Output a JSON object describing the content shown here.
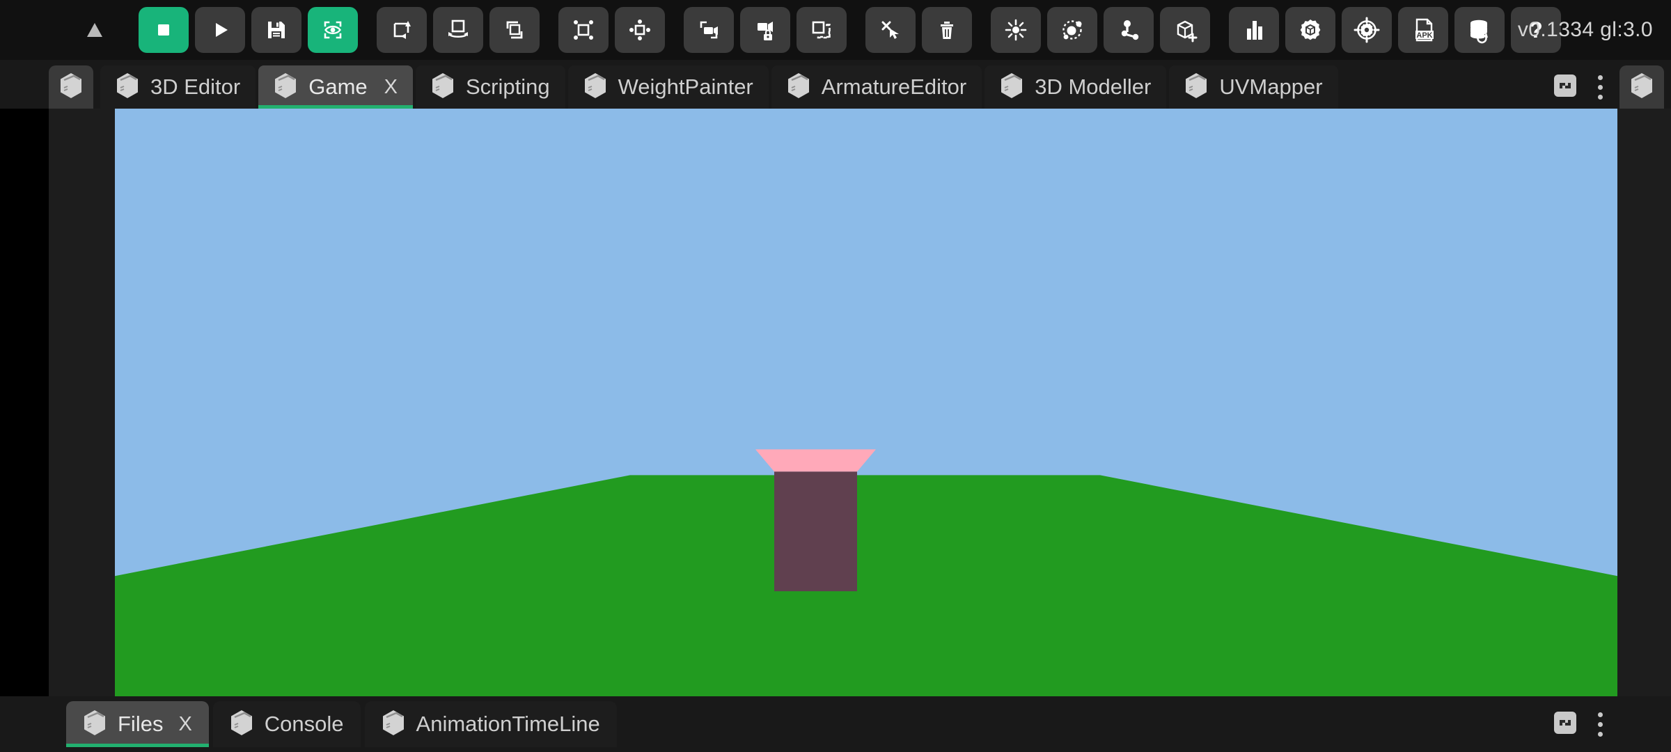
{
  "app": {
    "version_label": "v0.1334 gl:3.0",
    "accent_color": "#22b06f",
    "toolbar_active_color": "#18b47a",
    "panel_bg": "#1d1d1d",
    "chrome_bg": "#191919",
    "button_bg": "#3b3b3b"
  },
  "toolbar": {
    "buttons": [
      {
        "name": "collapse-toolbar-button",
        "icon": "triangle-up-icon",
        "label": "Collapse",
        "state": "normal"
      },
      {
        "name": "stop-button",
        "icon": "stop-square-icon",
        "label": "Stop",
        "state": "active"
      },
      {
        "name": "play-button",
        "icon": "play-triangle-icon",
        "label": "Play",
        "state": "normal"
      },
      {
        "name": "save-button",
        "icon": "floppy-disk-icon",
        "label": "Save",
        "state": "normal"
      },
      {
        "name": "preview-visibility-button",
        "icon": "eye-frame-icon",
        "label": "Preview",
        "state": "active"
      },
      {
        "name": "move-object-button",
        "icon": "square-arrow-loop-icon",
        "label": "Move",
        "state": "normal"
      },
      {
        "name": "rotate-object-button",
        "icon": "square-rotate-icon",
        "label": "Rotate",
        "state": "normal"
      },
      {
        "name": "scale-object-button",
        "icon": "square-overlap-icon",
        "label": "Scale",
        "state": "normal"
      },
      {
        "name": "select-box-button",
        "icon": "square-corner-dots-icon",
        "label": "Select Box",
        "state": "normal"
      },
      {
        "name": "pivot-button",
        "icon": "square-side-dots-icon",
        "label": "Pivot",
        "state": "normal"
      },
      {
        "name": "camera-add-button",
        "icon": "camera-frame-icon",
        "label": "Add Camera",
        "state": "normal"
      },
      {
        "name": "camera-lock-button",
        "icon": "camera-lock-icon",
        "label": "Lock Camera",
        "state": "normal"
      },
      {
        "name": "duplicate-button",
        "icon": "square-dashed-copy-icon",
        "label": "Duplicate",
        "state": "normal"
      },
      {
        "name": "click-select-button",
        "icon": "cursor-sparkle-icon",
        "label": "Click Select",
        "state": "normal"
      },
      {
        "name": "delete-button",
        "icon": "trash-icon",
        "label": "Delete",
        "state": "normal"
      },
      {
        "name": "light-button",
        "icon": "sun-light-icon",
        "label": "Light",
        "state": "normal"
      },
      {
        "name": "particle-button",
        "icon": "atom-orbit-icon",
        "label": "Particles",
        "state": "normal"
      },
      {
        "name": "node-graph-button",
        "icon": "node-network-icon",
        "label": "Nodes",
        "state": "normal"
      },
      {
        "name": "add-primitive-button",
        "icon": "cube-plus-icon",
        "label": "Add Primitive",
        "state": "normal"
      },
      {
        "name": "statistics-button",
        "icon": "bar-chart-icon",
        "label": "Statistics",
        "state": "normal"
      },
      {
        "name": "object-settings-button",
        "icon": "gear-cube-icon",
        "label": "Object Settings",
        "state": "normal"
      },
      {
        "name": "engine-settings-button",
        "icon": "gear-target-icon",
        "label": "Engine Settings",
        "state": "normal"
      },
      {
        "name": "export-apk-button",
        "icon": "apk-file-icon",
        "label": "Export APK",
        "state": "normal"
      },
      {
        "name": "database-refresh-button",
        "icon": "database-refresh-icon",
        "label": "Reload Assets",
        "state": "normal"
      },
      {
        "name": "help-button",
        "icon": "question-mark-icon",
        "label": "Help",
        "state": "normal"
      }
    ]
  },
  "top_tabs": {
    "corner_icon": "cube-icon",
    "items": [
      {
        "label": "3D Editor",
        "icon": "cube-icon",
        "active": false,
        "closable": false
      },
      {
        "label": "Game",
        "icon": "cube-icon",
        "active": true,
        "closable": true,
        "close_label": "X"
      },
      {
        "label": "Scripting",
        "icon": "cube-icon",
        "active": false,
        "closable": false
      },
      {
        "label": "WeightPainter",
        "icon": "cube-icon",
        "active": false,
        "closable": false
      },
      {
        "label": "ArmatureEditor",
        "icon": "cube-icon",
        "active": false,
        "closable": false
      },
      {
        "label": "3D Modeller",
        "icon": "cube-icon",
        "active": false,
        "closable": false
      },
      {
        "label": "UVMapper",
        "icon": "cube-icon",
        "active": false,
        "closable": false
      }
    ],
    "actions": [
      {
        "name": "split-panel-button",
        "icon": "split-panel-icon",
        "label": "Split Panel"
      },
      {
        "name": "tab-overflow-menu",
        "icon": "kebab-menu-icon",
        "label": "More"
      }
    ],
    "right_corner_icon": "cube-icon"
  },
  "bottom_tabs": {
    "items": [
      {
        "label": "Files",
        "icon": "cube-icon",
        "active": true,
        "closable": true,
        "close_label": "X"
      },
      {
        "label": "Console",
        "icon": "cube-icon",
        "active": false,
        "closable": false
      },
      {
        "label": "AnimationTimeLine",
        "icon": "cube-icon",
        "active": false,
        "closable": false
      }
    ],
    "actions": [
      {
        "name": "split-panel-button",
        "icon": "split-panel-icon",
        "label": "Split Panel"
      },
      {
        "name": "panel-overflow-menu",
        "icon": "kebab-menu-icon",
        "label": "More"
      }
    ]
  },
  "viewport": {
    "name": "game-preview-viewport",
    "sky_color": "#8cbbe8",
    "ground_color": "#229b20",
    "cube_front_color": "#60404f",
    "cube_top_color": "#ffa9b9",
    "scene_objects": [
      {
        "name": "terrain-plane",
        "type": "plane",
        "color": "#229b20"
      },
      {
        "name": "player-cube",
        "type": "cube",
        "front_color": "#60404f",
        "top_color": "#ffa9b9"
      }
    ]
  }
}
